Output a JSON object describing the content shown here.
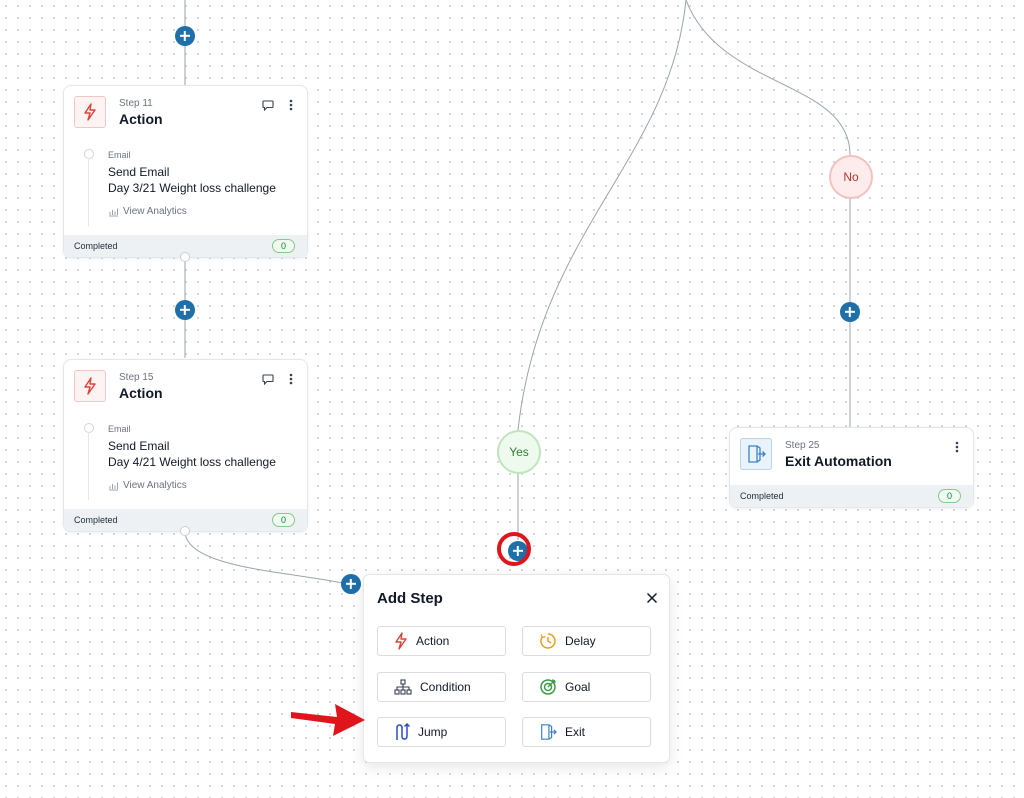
{
  "cards": [
    {
      "step_no": "Step 11",
      "step_type": "Action",
      "sub_type": "Email",
      "sub_title": "Send Email",
      "sub_detail": "Day 3/21 Weight loss challenge",
      "analytics": "View Analytics",
      "status": "Completed",
      "count": "0"
    },
    {
      "step_no": "Step 15",
      "step_type": "Action",
      "sub_type": "Email",
      "sub_title": "Send Email",
      "sub_detail": "Day 4/21 Weight loss challenge",
      "analytics": "View Analytics",
      "status": "Completed",
      "count": "0"
    }
  ],
  "branches": {
    "no": "No",
    "yes": "Yes"
  },
  "exit_card": {
    "step_no": "Step 25",
    "step_type": "Exit Automation",
    "status": "Completed",
    "count": "0"
  },
  "add_step": {
    "title": "Add Step",
    "options": [
      "Action",
      "Delay",
      "Condition",
      "Goal",
      "Jump",
      "Exit"
    ]
  },
  "colors": {
    "accent_blue": "#1f6fa8",
    "highlight_red": "#e0141b",
    "action_red": "#d9443a",
    "delay_orange": "#e6a21f",
    "goal_green": "#3a9b45",
    "jump_blue": "#2b4fc4"
  },
  "icons": [
    "lightning-icon",
    "comment-icon",
    "kebab-icon",
    "analytics-icon",
    "exit-door-icon",
    "close-icon",
    "clock-icon",
    "hierarchy-icon",
    "target-icon",
    "jump-icon",
    "plus-icon"
  ]
}
